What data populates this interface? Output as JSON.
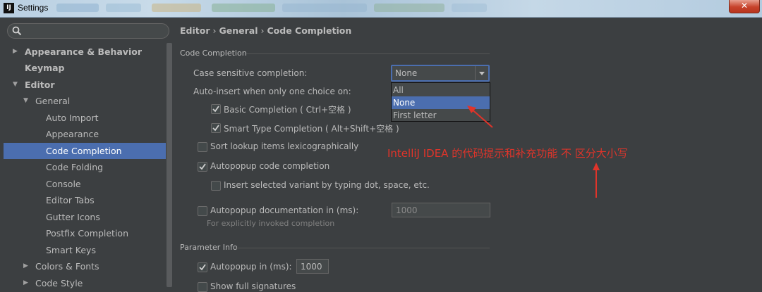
{
  "window": {
    "app_icon": "IJ",
    "title": "Settings",
    "close_label": "✕"
  },
  "search": {
    "placeholder": "",
    "icon": "search-icon"
  },
  "tree": [
    {
      "label": "Appearance & Behavior",
      "expanded": false
    },
    {
      "label": "Keymap"
    },
    {
      "label": "Editor",
      "expanded": true
    },
    {
      "label": "General",
      "expanded": true
    },
    {
      "label": "Auto Import"
    },
    {
      "label": "Appearance"
    },
    {
      "label": "Code Completion",
      "selected": true
    },
    {
      "label": "Code Folding"
    },
    {
      "label": "Console"
    },
    {
      "label": "Editor Tabs"
    },
    {
      "label": "Gutter Icons"
    },
    {
      "label": "Postfix Completion"
    },
    {
      "label": "Smart Keys"
    },
    {
      "label": "Colors & Fonts",
      "expanded": false
    },
    {
      "label": "Code Style",
      "expanded": false
    }
  ],
  "breadcrumb": [
    "Editor",
    "General",
    "Code Completion"
  ],
  "breadcrumb_sep": "›",
  "code_completion": {
    "section_title": "Code Completion",
    "case_sensitive_label": "Case sensitive completion:",
    "case_sensitive_value": "None",
    "case_sensitive_options": [
      "All",
      "None",
      "First letter"
    ],
    "auto_insert_label": "Auto-insert when only one choice on:",
    "basic_completion": "Basic Completion ( Ctrl+空格 )",
    "smart_type_completion": "Smart Type Completion ( Alt+Shift+空格 )",
    "sort_lookup": "Sort lookup items lexicographically",
    "autopopup_code": "Autopopup code completion",
    "insert_selected_variant": "Insert selected variant by typing dot, space, etc.",
    "autopopup_doc": "Autopopup documentation in (ms):",
    "autopopup_doc_value": "1000",
    "autopopup_doc_hint": "For explicitly invoked completion"
  },
  "parameter_info": {
    "section_title": "Parameter Info",
    "autopopup_label": "Autopopup in (ms):",
    "autopopup_value": "1000",
    "show_full_signatures": "Show full signatures"
  },
  "checkbox_states": {
    "basic_completion": true,
    "smart_type_completion": true,
    "sort_lookup": false,
    "autopopup_code": true,
    "insert_selected_variant": false,
    "autopopup_doc": false,
    "param_autopopup": true,
    "show_full_signatures": false
  },
  "annotation": {
    "text": "IntelliJ IDEA 的代码提示和补充功能 不 区分大小写",
    "color": "#e0342a"
  },
  "colors": {
    "selection": "#4b6eaf",
    "panel": "#3c3f41"
  }
}
